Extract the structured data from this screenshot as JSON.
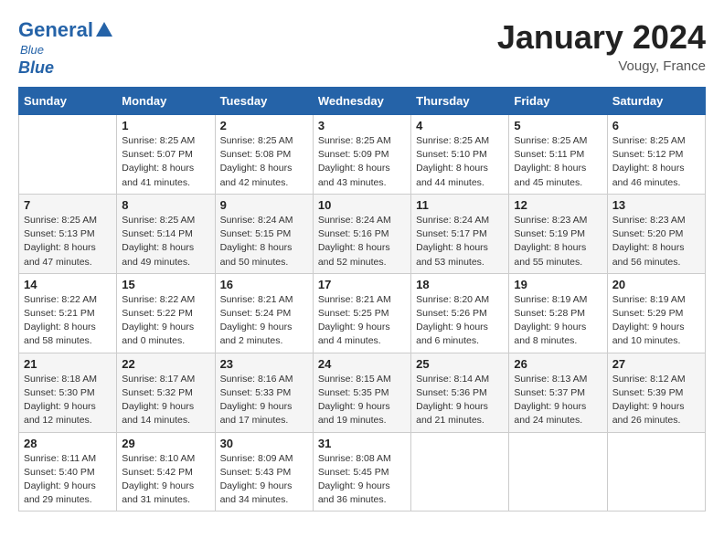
{
  "logo": {
    "name_part1": "General",
    "name_part2": "Blue",
    "tagline": "Blue"
  },
  "header": {
    "month": "January 2024",
    "location": "Vougy, France"
  },
  "weekdays": [
    "Sunday",
    "Monday",
    "Tuesday",
    "Wednesday",
    "Thursday",
    "Friday",
    "Saturday"
  ],
  "weeks": [
    [
      {
        "day": "",
        "sunrise": "",
        "sunset": "",
        "daylight": ""
      },
      {
        "day": "1",
        "sunrise": "Sunrise: 8:25 AM",
        "sunset": "Sunset: 5:07 PM",
        "daylight": "Daylight: 8 hours and 41 minutes."
      },
      {
        "day": "2",
        "sunrise": "Sunrise: 8:25 AM",
        "sunset": "Sunset: 5:08 PM",
        "daylight": "Daylight: 8 hours and 42 minutes."
      },
      {
        "day": "3",
        "sunrise": "Sunrise: 8:25 AM",
        "sunset": "Sunset: 5:09 PM",
        "daylight": "Daylight: 8 hours and 43 minutes."
      },
      {
        "day": "4",
        "sunrise": "Sunrise: 8:25 AM",
        "sunset": "Sunset: 5:10 PM",
        "daylight": "Daylight: 8 hours and 44 minutes."
      },
      {
        "day": "5",
        "sunrise": "Sunrise: 8:25 AM",
        "sunset": "Sunset: 5:11 PM",
        "daylight": "Daylight: 8 hours and 45 minutes."
      },
      {
        "day": "6",
        "sunrise": "Sunrise: 8:25 AM",
        "sunset": "Sunset: 5:12 PM",
        "daylight": "Daylight: 8 hours and 46 minutes."
      }
    ],
    [
      {
        "day": "7",
        "sunrise": "Sunrise: 8:25 AM",
        "sunset": "Sunset: 5:13 PM",
        "daylight": "Daylight: 8 hours and 47 minutes."
      },
      {
        "day": "8",
        "sunrise": "Sunrise: 8:25 AM",
        "sunset": "Sunset: 5:14 PM",
        "daylight": "Daylight: 8 hours and 49 minutes."
      },
      {
        "day": "9",
        "sunrise": "Sunrise: 8:24 AM",
        "sunset": "Sunset: 5:15 PM",
        "daylight": "Daylight: 8 hours and 50 minutes."
      },
      {
        "day": "10",
        "sunrise": "Sunrise: 8:24 AM",
        "sunset": "Sunset: 5:16 PM",
        "daylight": "Daylight: 8 hours and 52 minutes."
      },
      {
        "day": "11",
        "sunrise": "Sunrise: 8:24 AM",
        "sunset": "Sunset: 5:17 PM",
        "daylight": "Daylight: 8 hours and 53 minutes."
      },
      {
        "day": "12",
        "sunrise": "Sunrise: 8:23 AM",
        "sunset": "Sunset: 5:19 PM",
        "daylight": "Daylight: 8 hours and 55 minutes."
      },
      {
        "day": "13",
        "sunrise": "Sunrise: 8:23 AM",
        "sunset": "Sunset: 5:20 PM",
        "daylight": "Daylight: 8 hours and 56 minutes."
      }
    ],
    [
      {
        "day": "14",
        "sunrise": "Sunrise: 8:22 AM",
        "sunset": "Sunset: 5:21 PM",
        "daylight": "Daylight: 8 hours and 58 minutes."
      },
      {
        "day": "15",
        "sunrise": "Sunrise: 8:22 AM",
        "sunset": "Sunset: 5:22 PM",
        "daylight": "Daylight: 9 hours and 0 minutes."
      },
      {
        "day": "16",
        "sunrise": "Sunrise: 8:21 AM",
        "sunset": "Sunset: 5:24 PM",
        "daylight": "Daylight: 9 hours and 2 minutes."
      },
      {
        "day": "17",
        "sunrise": "Sunrise: 8:21 AM",
        "sunset": "Sunset: 5:25 PM",
        "daylight": "Daylight: 9 hours and 4 minutes."
      },
      {
        "day": "18",
        "sunrise": "Sunrise: 8:20 AM",
        "sunset": "Sunset: 5:26 PM",
        "daylight": "Daylight: 9 hours and 6 minutes."
      },
      {
        "day": "19",
        "sunrise": "Sunrise: 8:19 AM",
        "sunset": "Sunset: 5:28 PM",
        "daylight": "Daylight: 9 hours and 8 minutes."
      },
      {
        "day": "20",
        "sunrise": "Sunrise: 8:19 AM",
        "sunset": "Sunset: 5:29 PM",
        "daylight": "Daylight: 9 hours and 10 minutes."
      }
    ],
    [
      {
        "day": "21",
        "sunrise": "Sunrise: 8:18 AM",
        "sunset": "Sunset: 5:30 PM",
        "daylight": "Daylight: 9 hours and 12 minutes."
      },
      {
        "day": "22",
        "sunrise": "Sunrise: 8:17 AM",
        "sunset": "Sunset: 5:32 PM",
        "daylight": "Daylight: 9 hours and 14 minutes."
      },
      {
        "day": "23",
        "sunrise": "Sunrise: 8:16 AM",
        "sunset": "Sunset: 5:33 PM",
        "daylight": "Daylight: 9 hours and 17 minutes."
      },
      {
        "day": "24",
        "sunrise": "Sunrise: 8:15 AM",
        "sunset": "Sunset: 5:35 PM",
        "daylight": "Daylight: 9 hours and 19 minutes."
      },
      {
        "day": "25",
        "sunrise": "Sunrise: 8:14 AM",
        "sunset": "Sunset: 5:36 PM",
        "daylight": "Daylight: 9 hours and 21 minutes."
      },
      {
        "day": "26",
        "sunrise": "Sunrise: 8:13 AM",
        "sunset": "Sunset: 5:37 PM",
        "daylight": "Daylight: 9 hours and 24 minutes."
      },
      {
        "day": "27",
        "sunrise": "Sunrise: 8:12 AM",
        "sunset": "Sunset: 5:39 PM",
        "daylight": "Daylight: 9 hours and 26 minutes."
      }
    ],
    [
      {
        "day": "28",
        "sunrise": "Sunrise: 8:11 AM",
        "sunset": "Sunset: 5:40 PM",
        "daylight": "Daylight: 9 hours and 29 minutes."
      },
      {
        "day": "29",
        "sunrise": "Sunrise: 8:10 AM",
        "sunset": "Sunset: 5:42 PM",
        "daylight": "Daylight: 9 hours and 31 minutes."
      },
      {
        "day": "30",
        "sunrise": "Sunrise: 8:09 AM",
        "sunset": "Sunset: 5:43 PM",
        "daylight": "Daylight: 9 hours and 34 minutes."
      },
      {
        "day": "31",
        "sunrise": "Sunrise: 8:08 AM",
        "sunset": "Sunset: 5:45 PM",
        "daylight": "Daylight: 9 hours and 36 minutes."
      },
      {
        "day": "",
        "sunrise": "",
        "sunset": "",
        "daylight": ""
      },
      {
        "day": "",
        "sunrise": "",
        "sunset": "",
        "daylight": ""
      },
      {
        "day": "",
        "sunrise": "",
        "sunset": "",
        "daylight": ""
      }
    ]
  ]
}
